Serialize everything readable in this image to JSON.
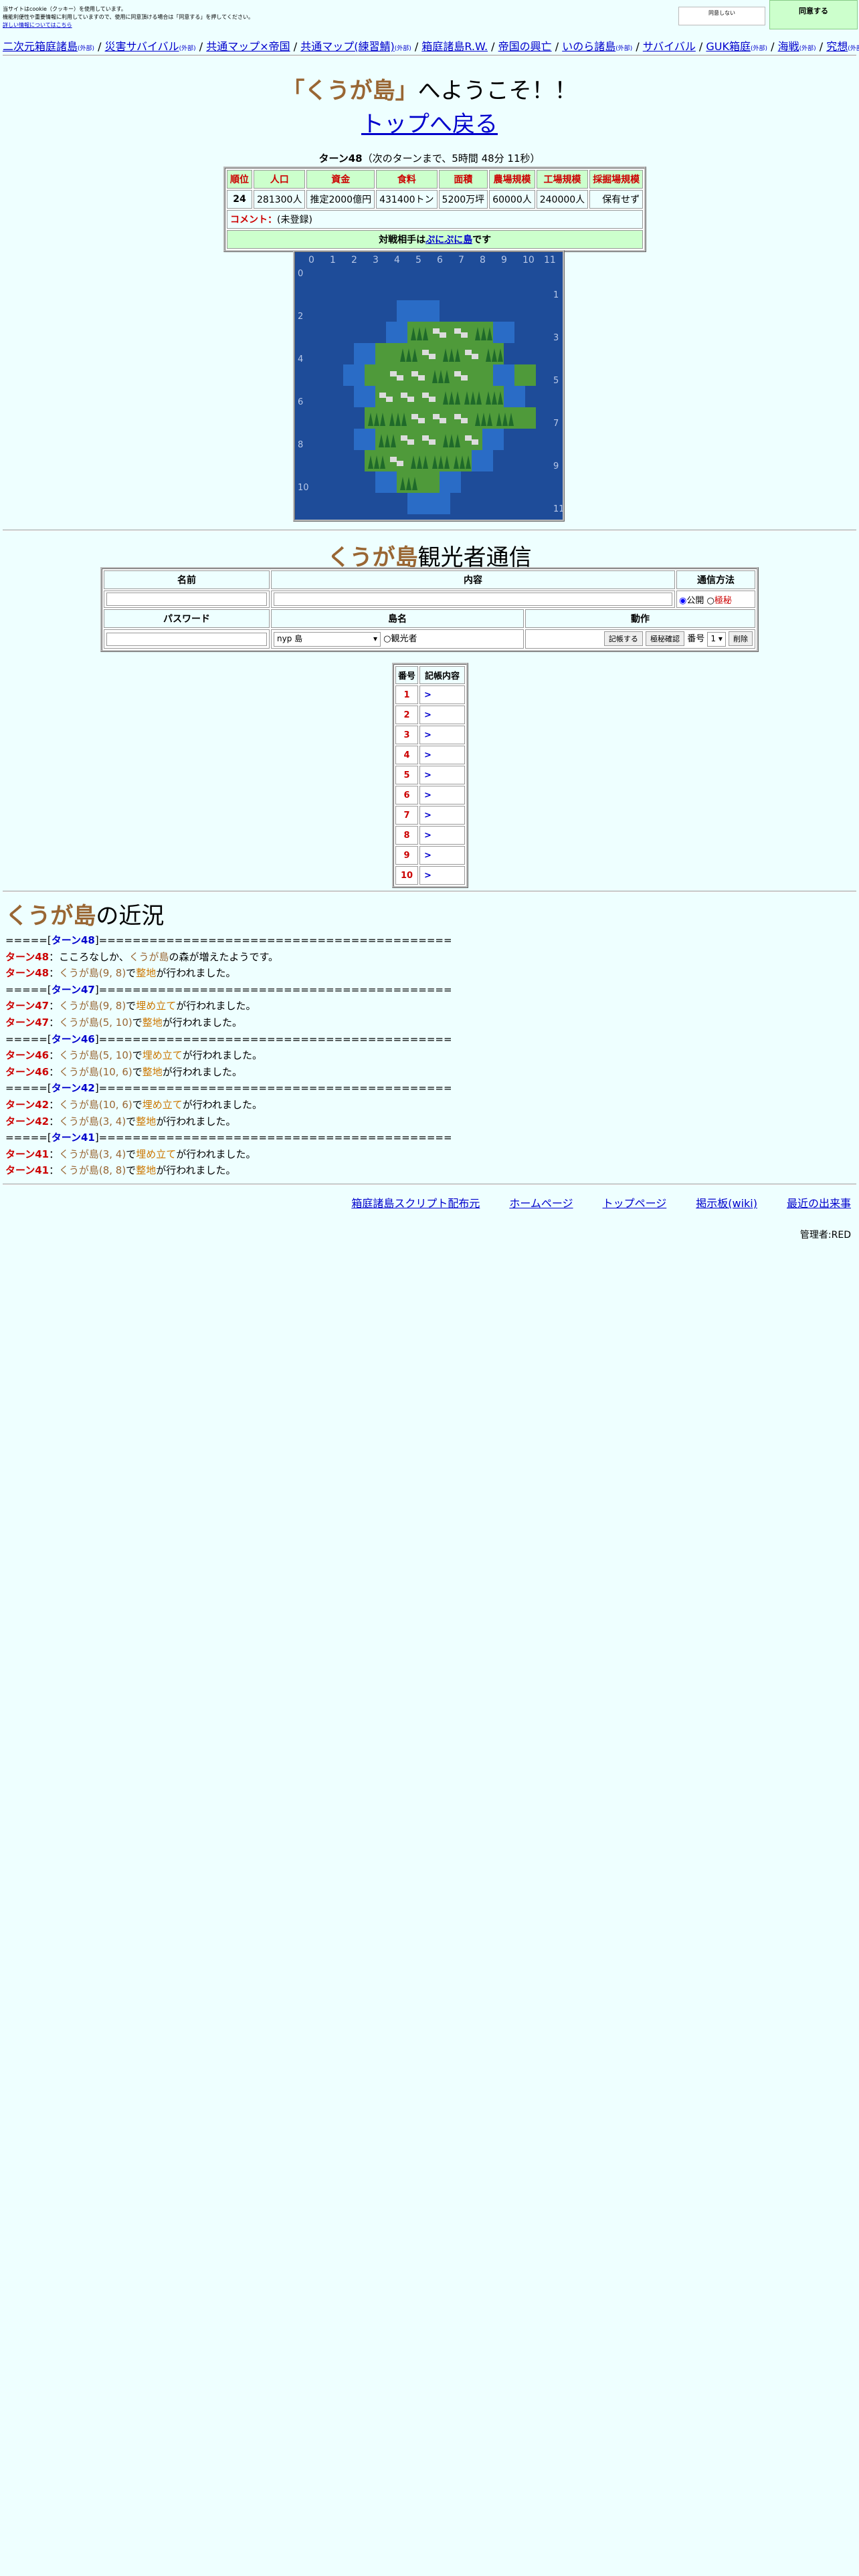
{
  "cookie": {
    "lines": [
      "当サイトはcookie（クッキー）を使用しています。",
      "機能利便性や重要情報に利用していますので、使用に同意頂ける場合は「同意する」を押してください。"
    ],
    "link": "詳しい情報についてはこちら",
    "decline_label": "同意しない",
    "agree_label": "同意する"
  },
  "nav": {
    "items": [
      {
        "label": "二次元箱庭諸島",
        "tag": "(外部)"
      },
      {
        "label": "災害サバイバル",
        "tag": "(外部)"
      },
      {
        "label": "共通マップ×帝国",
        "tag": ""
      },
      {
        "label": "共通マップ(練習鯖)",
        "tag": "(外部)"
      },
      {
        "label": "箱庭諸島R.W.",
        "tag": ""
      },
      {
        "label": "帝国の興亡",
        "tag": ""
      },
      {
        "label": "いのら諸島",
        "tag": "(外部)"
      },
      {
        "label": "サバイバル",
        "tag": ""
      },
      {
        "label": "GUK箱庭",
        "tag": "(外部)"
      },
      {
        "label": "海戦",
        "tag": "(外部)"
      },
      {
        "label": "究想",
        "tag": "(外部)"
      }
    ]
  },
  "header": {
    "title_open": "「",
    "island_name": "くうが島",
    "title_close": "」",
    "title_suffix": "へようこそ！！",
    "top_link": "トップへ戻る",
    "turn_label": "ターン48",
    "turn_next": "（次のターンまで、5時間 48分 11秒）"
  },
  "status": {
    "headers": [
      "順位",
      "人口",
      "資金",
      "食料",
      "面積",
      "農場規模",
      "工場規模",
      "採掘場規模"
    ],
    "values": [
      "24",
      "281300人",
      "推定2000億円",
      "431400トン",
      "5200万坪",
      "60000人",
      "240000人",
      "保有せず"
    ],
    "comment_label": "コメント：",
    "comment_value": "(未登録)",
    "opponent_prefix": "対戦相手は",
    "opponent_link": "ぷにぷに島",
    "opponent_suffix": "です"
  },
  "map": {
    "col_labels": [
      "0",
      "1",
      "2",
      "3",
      "4",
      "5",
      "6",
      "7",
      "8",
      "9",
      "10",
      "11"
    ],
    "left_rows": [
      "0",
      "2",
      "4",
      "6",
      "8",
      "10"
    ],
    "right_rows": [
      "1",
      "3",
      "5",
      "7",
      "9",
      "11"
    ],
    "colors": {
      "sea": "#1e4c99",
      "shallow": "#2a6cc6",
      "plain": "#4f9a3a",
      "forest": "#1f6a2a",
      "town": "#dcdcdc"
    }
  },
  "kanko": {
    "title_island": "くうが島",
    "title_suffix": "観光者通信",
    "col_name": "名前",
    "col_content": "内容",
    "col_method": "通信方法",
    "radio_public": "公開",
    "radio_secret": "極秘",
    "col_password": "パスワード",
    "col_island": "島名",
    "col_action": "動作",
    "island_select": "nyp 島",
    "radio_tourist": "観光者",
    "btn_post": "記帳する",
    "btn_confirm": "極秘確認",
    "num_label": "番号",
    "num_value": "1",
    "btn_delete": "削除"
  },
  "log": {
    "col_num": "番号",
    "col_content": "記帳内容",
    "rows": [
      {
        "num": "1",
        "content": ">"
      },
      {
        "num": "2",
        "content": ">"
      },
      {
        "num": "3",
        "content": ">"
      },
      {
        "num": "4",
        "content": ">"
      },
      {
        "num": "5",
        "content": ">"
      },
      {
        "num": "6",
        "content": ">"
      },
      {
        "num": "7",
        "content": ">"
      },
      {
        "num": "8",
        "content": ">"
      },
      {
        "num": "9",
        "content": ">"
      },
      {
        "num": "10",
        "content": ">"
      }
    ]
  },
  "recent": {
    "title_island": "くうが島",
    "title_suffix": "の近況",
    "entries": [
      {
        "type": "turn",
        "turn": "ターン48"
      },
      {
        "type": "event",
        "turn": "ターン48",
        "text_before": "：こころなしか、",
        "island": "くうが島",
        "text_after": "の森が増えたようです。"
      },
      {
        "type": "event",
        "turn": "ターン48",
        "text_before": "：",
        "island": "くうが島(9, 8)",
        "mid": "で",
        "act": "整地",
        "text_after": "が行われました。"
      },
      {
        "type": "turn",
        "turn": "ターン47"
      },
      {
        "type": "event",
        "turn": "ターン47",
        "text_before": "：",
        "island": "くうが島(9, 8)",
        "mid": "で",
        "act": "埋め立て",
        "text_after": "が行われました。"
      },
      {
        "type": "event",
        "turn": "ターン47",
        "text_before": "：",
        "island": "くうが島(5, 10)",
        "mid": "で",
        "act": "整地",
        "text_after": "が行われました。"
      },
      {
        "type": "turn",
        "turn": "ターン46"
      },
      {
        "type": "event",
        "turn": "ターン46",
        "text_before": "：",
        "island": "くうが島(5, 10)",
        "mid": "で",
        "act": "埋め立て",
        "text_after": "が行われました。"
      },
      {
        "type": "event",
        "turn": "ターン46",
        "text_before": "：",
        "island": "くうが島(10, 6)",
        "mid": "で",
        "act": "整地",
        "text_after": "が行われました。"
      },
      {
        "type": "turn",
        "turn": "ターン42"
      },
      {
        "type": "event",
        "turn": "ターン42",
        "text_before": "：",
        "island": "くうが島(10, 6)",
        "mid": "で",
        "act": "埋め立て",
        "text_after": "が行われました。"
      },
      {
        "type": "event",
        "turn": "ターン42",
        "text_before": "：",
        "island": "くうが島(3, 4)",
        "mid": "で",
        "act": "整地",
        "text_after": "が行われました。"
      },
      {
        "type": "turn",
        "turn": "ターン41"
      },
      {
        "type": "event",
        "turn": "ターン41",
        "text_before": "：",
        "island": "くうが島(3, 4)",
        "mid": "で",
        "act": "埋め立て",
        "text_after": "が行われました。"
      },
      {
        "type": "event",
        "turn": "ターン41",
        "text_before": "：",
        "island": "くうが島(8, 8)",
        "mid": "で",
        "act": "整地",
        "text_after": "が行われました。"
      }
    ],
    "sep_open": "=====[",
    "sep_close": "]=========================================="
  },
  "footer": {
    "links": [
      "箱庭諸島スクリプト配布元",
      "ホームページ",
      "トップページ",
      "掲示板(wiki)",
      "最近の出来事"
    ],
    "admin": "管理者:RED"
  }
}
